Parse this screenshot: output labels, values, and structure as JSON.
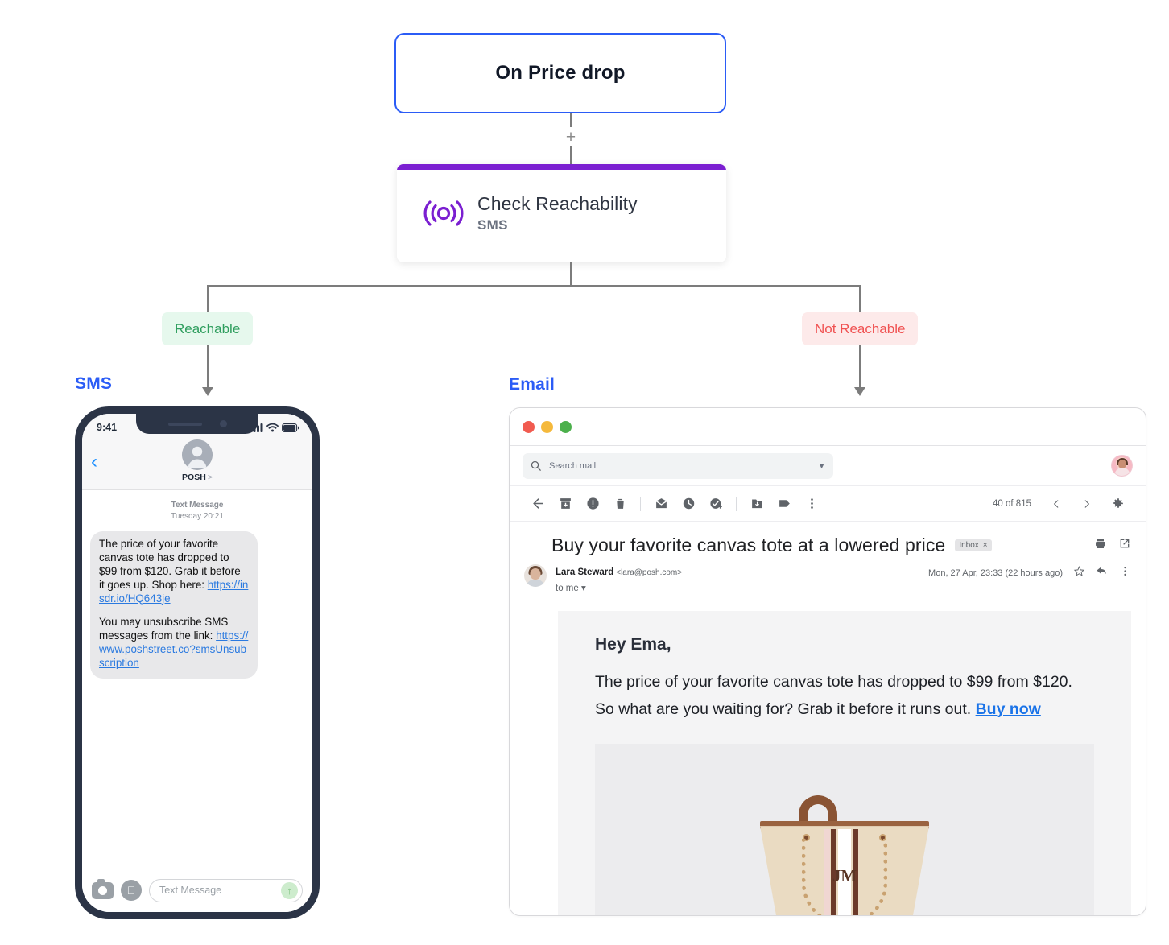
{
  "flow": {
    "trigger": {
      "label": "On Price  drop"
    },
    "add_step": {
      "label": "+"
    },
    "action": {
      "title": "Check Reachability",
      "subtitle": "SMS",
      "icon": "broadcast-icon",
      "accent_color": "#7b1fd1"
    },
    "branches": [
      {
        "label": "Reachable",
        "color": "#2f9e5e",
        "bg": "#e6f8ed"
      },
      {
        "label": "Not Reachable",
        "color": "#f05252",
        "bg": "#fdeaea"
      }
    ]
  },
  "sms_channel": {
    "section_label": "SMS",
    "statusbar": {
      "time": "9:41"
    },
    "header": {
      "contact": "POSH",
      "chevron": ">"
    },
    "conversation": {
      "meta_title": "Text Message",
      "meta_time": "Tuesday 20:21",
      "message_part1": "The price of your favorite canvas tote has dropped to $99 from $120. Grab it before it goes up. Shop here: ",
      "message_link1": "https://insdr.io/HQ643je",
      "message_part2": "You may unsubscribe SMS messages from the link: ",
      "message_link2": "https://www.poshstreet.co?smsUnsubscription"
    },
    "input": {
      "placeholder": "Text Message"
    }
  },
  "email_channel": {
    "section_label": "Email",
    "search": {
      "placeholder": "Search mail"
    },
    "toolbar": {
      "count": "40 of 815",
      "icons": [
        "back-arrow-icon",
        "archive-icon",
        "report-spam-icon",
        "delete-icon",
        "mark-unread-icon",
        "snooze-icon",
        "add-to-tasks-icon",
        "move-to-folder-icon",
        "label-icon",
        "more-options-icon"
      ]
    },
    "message": {
      "subject": "Buy your favorite canvas tote at a lowered price",
      "label_chip": "Inbox",
      "label_chip_close": "×",
      "sender_name": "Lara Steward",
      "sender_email": "<lara@posh.com>",
      "recipients": "to me",
      "date": "Mon, 27 Apr, 23:33 (22 hours ago)",
      "body_greeting": "Hey Ema,",
      "body_text": "The price of your favorite canvas tote has dropped to $99 from $120. So what are you waiting for? Grab it before it runs out. ",
      "body_cta": "Buy now",
      "product_monogram": "JM"
    }
  }
}
